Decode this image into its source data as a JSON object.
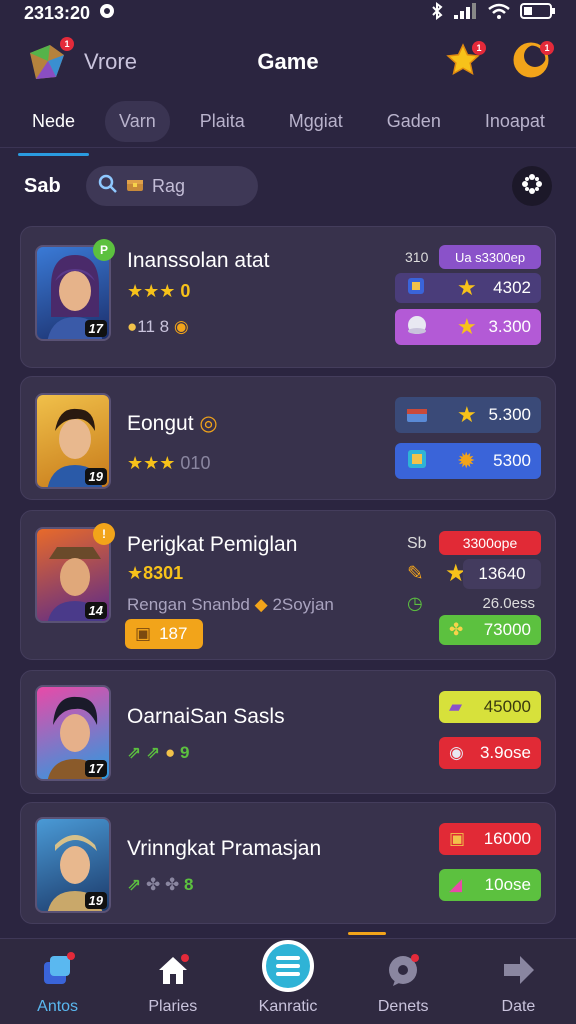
{
  "status_bar": {
    "time": "2313:20"
  },
  "header": {
    "app_name": "Vrore",
    "title": "Game"
  },
  "tabs": [
    "Nede",
    "Varn",
    "Plaita",
    "Mggiat",
    "Gaden",
    "Inoapat"
  ],
  "filter": {
    "sort_label": "Sab",
    "search_placeholder": "Rag"
  },
  "cards": [
    {
      "name": "Inanssolan atat",
      "stars_text": "0",
      "stat_text": "11 8",
      "level": "17",
      "tag_text": "310",
      "tag_value": "Ua s3300ep",
      "offers": [
        {
          "value": "4302"
        },
        {
          "value": "3.300"
        }
      ]
    },
    {
      "name": "Eongut",
      "stars_text": "010",
      "level": "19",
      "offers": [
        {
          "value": "5.300"
        },
        {
          "value": "5300"
        }
      ]
    },
    {
      "name": "Perigkat Pemiglan",
      "stars_text": "8301",
      "stat_text": "Rengan Snanbd",
      "stat_extra": "2Soyjan",
      "chip_text": "187",
      "level": "14",
      "tag_text": "Sb",
      "tag_value": "3300ope",
      "offers": [
        {
          "value": "13640"
        },
        {
          "label": "26.0ess"
        },
        {
          "value": "73000"
        }
      ]
    },
    {
      "name": "OarnaiSan Sasls",
      "stat_text": "9",
      "level": "17",
      "offers": [
        {
          "value": "45000"
        },
        {
          "value": "3.9ose"
        }
      ]
    },
    {
      "name": "Vrinngkat Pramasjan",
      "stat_text": "8",
      "level": "19",
      "offers": [
        {
          "value": "16000"
        },
        {
          "value": "10ose"
        }
      ]
    }
  ],
  "nav": [
    "Antos",
    "Plaries",
    "Kanratic",
    "Denets",
    "Date"
  ],
  "colors": {
    "background": "#2b2540",
    "card": "#38324c",
    "accent": "#2a9be0",
    "purple": "#8a52c9",
    "blue": "#3a64d9",
    "green": "#5cc13f",
    "red": "#e12a36",
    "yellow": "#d7e13b"
  }
}
